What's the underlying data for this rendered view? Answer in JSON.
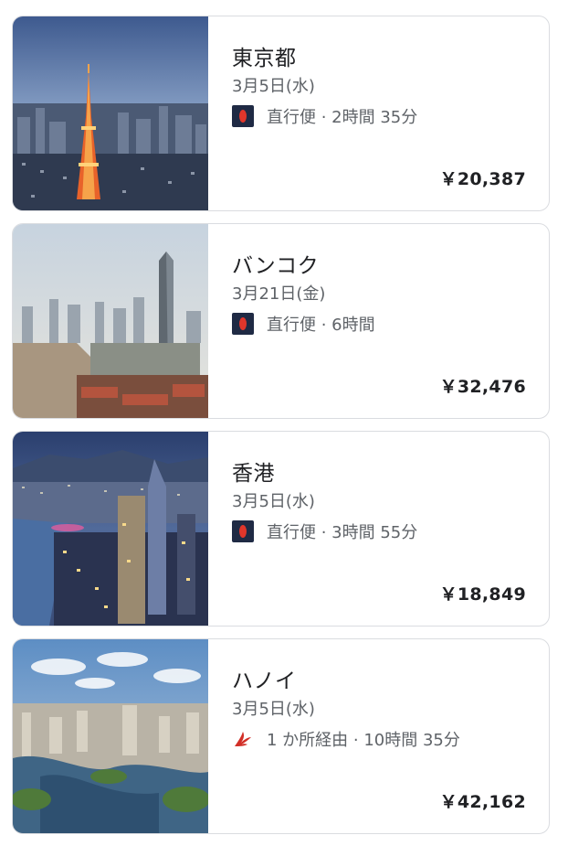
{
  "destinations": [
    {
      "city": "東京都",
      "date": "3月5日(水)",
      "airline_icon": "jal-logo",
      "flight": "直行便 · 2時間 35分",
      "price": "￥20,387"
    },
    {
      "city": "バンコク",
      "date": "3月21日(金)",
      "airline_icon": "jal-logo",
      "flight": "直行便 · 6時間",
      "price": "￥32,476"
    },
    {
      "city": "香港",
      "date": "3月5日(水)",
      "airline_icon": "jal-logo",
      "flight": "直行便 · 3時間 55分",
      "price": "￥18,849"
    },
    {
      "city": "ハノイ",
      "date": "3月5日(水)",
      "airline_icon": "crane-logo",
      "flight": "1 か所経由 · 10時間 35分",
      "price": "￥42,162"
    }
  ]
}
